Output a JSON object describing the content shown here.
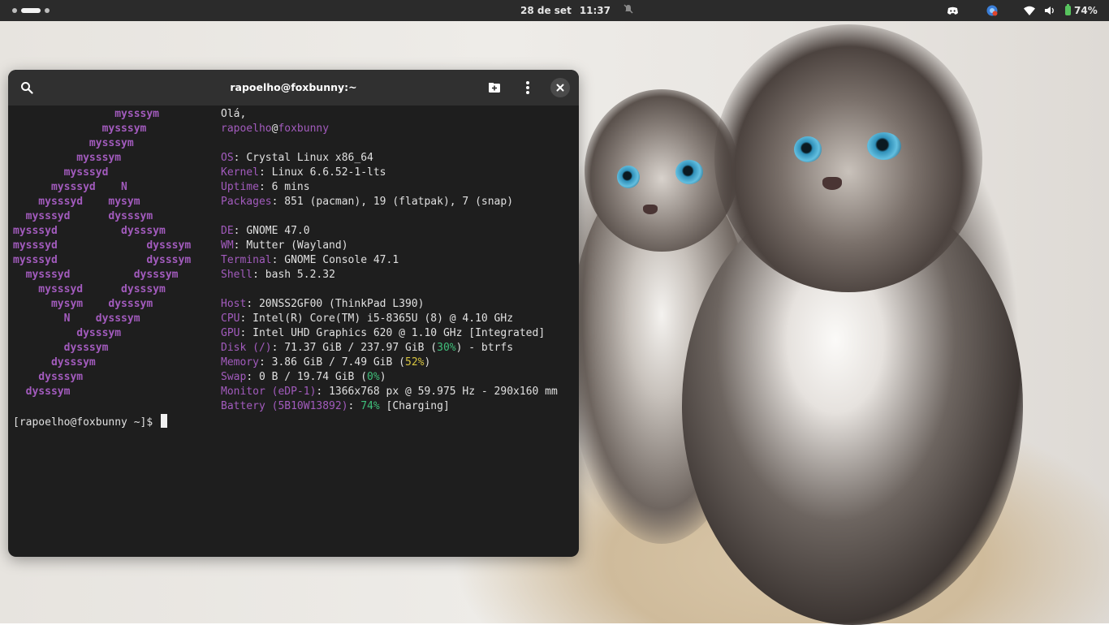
{
  "topbar": {
    "date": "28 de set",
    "time": "11:37",
    "battery_percent": "74%",
    "icons": [
      "discord-icon",
      "browser-icon",
      "wifi-icon",
      "volume-icon",
      "battery-icon",
      "notifications-muted-icon"
    ]
  },
  "terminal": {
    "title": "rapoelho@foxbunny:~",
    "logo_lines": [
      "                mysssym",
      "              mysssym",
      "            mysssym",
      "          mysssym",
      "        mysssyd",
      "      mysssyd    N",
      "    mysssyd    mysym",
      "  mysssyd      dysssym",
      "mysssyd          dysssym",
      "mysssyd              dysssym",
      "mysssyd              dysssym",
      "  mysssyd          dysssym",
      "    mysssyd      dysssym",
      "      mysym    dysssym",
      "        N    dysssym",
      "          dysssym",
      "        dysssym",
      "      dysssym",
      "    dysssym",
      "  dysssym"
    ],
    "greeting": "Olá,",
    "user": "rapoelho",
    "at": "@",
    "host": "foxbunny",
    "info": [
      {
        "key": "OS",
        "value": "Crystal Linux x86_64"
      },
      {
        "key": "Kernel",
        "value": "Linux 6.6.52-1-lts"
      },
      {
        "key": "Uptime",
        "value": "6 mins"
      },
      {
        "key": "Packages",
        "value": "851 (pacman), 19 (flatpak), 7 (snap)"
      },
      {
        "key": "DE",
        "value": "GNOME 47.0"
      },
      {
        "key": "WM",
        "value": "Mutter (Wayland)"
      },
      {
        "key": "Terminal",
        "value": "GNOME Console 47.1"
      },
      {
        "key": "Shell",
        "value": "bash 5.2.32"
      },
      {
        "key": "Host",
        "value": "20NSS2GF00 (ThinkPad L390)"
      },
      {
        "key": "CPU",
        "value": "Intel(R) Core(TM) i5-8365U (8) @ 4.10 GHz"
      },
      {
        "key": "GPU",
        "value": "Intel UHD Graphics 620 @ 1.10 GHz [Integrated]"
      },
      {
        "key": "Disk (/)",
        "value_a": "71.37 GiB / 237.97 GiB (",
        "pct": "30%",
        "value_b": ") - btrfs"
      },
      {
        "key": "Memory",
        "value_a": "3.86 GiB / 7.49 GiB (",
        "pct": "52%",
        "value_b": ")"
      },
      {
        "key": "Swap",
        "value_a": "0 B / 19.74 GiB (",
        "pct": "0%",
        "value_b": ")"
      },
      {
        "key": "Monitor (eDP-1)",
        "value": "1366x768 px @ 59.975 Hz - 290x160 mm"
      },
      {
        "key": "Battery (5B10W13892)",
        "pct": "74%",
        "value_b": " [Charging]"
      }
    ],
    "prompt": "[rapoelho@foxbunny ~]$"
  }
}
